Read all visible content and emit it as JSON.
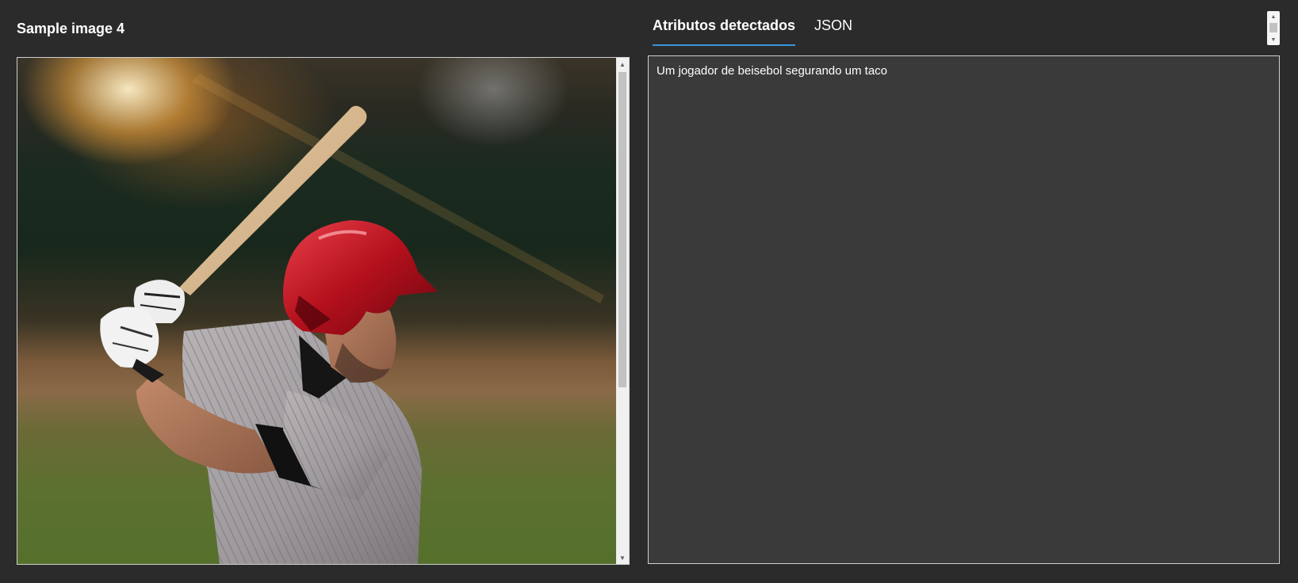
{
  "sample": {
    "title": "Sample image 4",
    "image_alt": "baseball player holding a bat"
  },
  "tabs": [
    {
      "label": "Atributos detectados",
      "active": true
    },
    {
      "label": "JSON",
      "active": false
    }
  ],
  "result": {
    "caption": "Um jogador de beisebol segurando um taco"
  },
  "colors": {
    "background": "#2b2b2b",
    "panel": "#3a3a3a",
    "tab_underline": "#3a96dd",
    "text": "#ffffff"
  }
}
